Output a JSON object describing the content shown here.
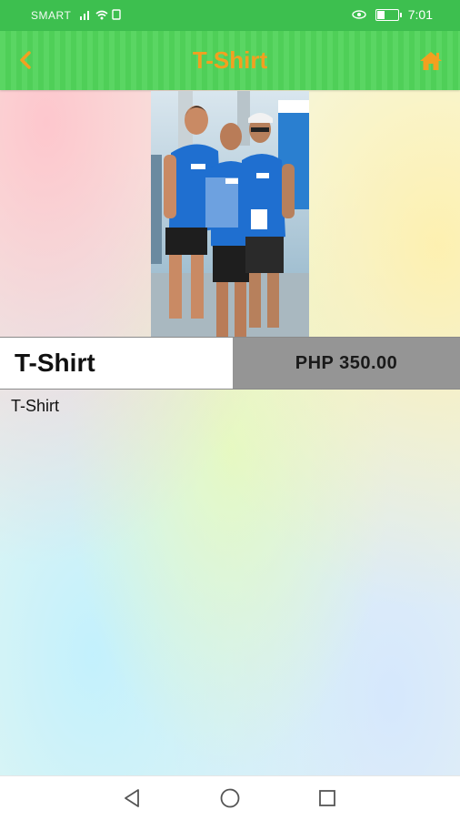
{
  "status_bar": {
    "carrier": "SMART",
    "time": "7:01"
  },
  "app_bar": {
    "title": "T-Shirt",
    "back_icon": "chevron-left-icon",
    "home_icon": "home-icon",
    "title_color": "#f2a020",
    "bar_color": "#5ad663"
  },
  "product": {
    "name": "T-Shirt",
    "price": "PHP 350.00",
    "description": "T-Shirt"
  },
  "nav_bar": {
    "icons": [
      "back-triangle-icon",
      "home-circle-icon",
      "recents-square-icon"
    ]
  }
}
